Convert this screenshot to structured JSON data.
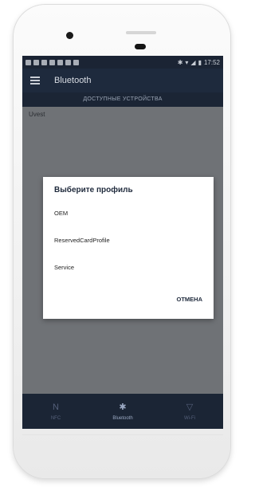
{
  "status_bar": {
    "time": "17:52",
    "icons": [
      "notification-icon",
      "bluetooth-icon",
      "wifi-icon",
      "signal-icon",
      "battery-icon"
    ]
  },
  "app_bar": {
    "title": "Bluetooth"
  },
  "section": {
    "header": "ДОСТУПНЫЕ УСТРОЙСТВА"
  },
  "devices": [
    {
      "label": "Uvest"
    }
  ],
  "dialog": {
    "title": "Выберите профиль",
    "options": [
      "OEM",
      "ReservedCardProfile",
      "Service"
    ],
    "cancel_label": "ОТМЕНА"
  },
  "bottom_nav": {
    "items": [
      {
        "label": "NFC",
        "icon": "nfc-icon"
      },
      {
        "label": "Bluetooth",
        "icon": "bluetooth-icon"
      },
      {
        "label": "Wi-Fi",
        "icon": "wifi-icon"
      }
    ],
    "active_index": 1
  },
  "colors": {
    "app_bar": "#1e2a3d",
    "screen_background": "#6f7276",
    "dialog_accent": "#1f2a3c"
  }
}
